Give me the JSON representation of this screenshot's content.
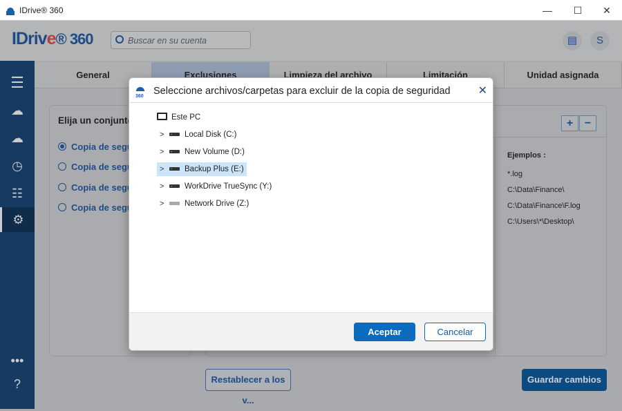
{
  "window": {
    "title": "IDrive® 360",
    "minimize": "—",
    "maximize": "☐",
    "close": "✕"
  },
  "header": {
    "brand_a": "IDriv",
    "brand_e": "e",
    "brand_b": "® 360",
    "search_placeholder": "Buscar en su cuenta",
    "avatar": "S"
  },
  "tabs": [
    "General",
    "Exclusiones",
    "Limpieza del archivo",
    "Limitación",
    "Unidad asignada"
  ],
  "left_panel": {
    "title": "Elija un conjunto",
    "options": [
      "Copia de seguridad",
      "Copia de seguridad",
      "Copia de seguridad",
      "Copia de seguridad"
    ]
  },
  "examples": {
    "title": "Ejemplos :",
    "items": [
      "*.log",
      "C:\\Data\\Finance\\",
      "C:\\Data\\Finance\\F.log",
      "C:\\Users\\*\\Desktop\\"
    ]
  },
  "buttons": {
    "add": "+",
    "remove": "−",
    "reset": "Restablecer a los v...",
    "save": "Guardar cambios"
  },
  "dialog": {
    "title": "Seleccione archivos/carpetas para excluir de la copia de seguridad",
    "root": "Este PC",
    "drives": [
      "Local Disk (C:)",
      "New Volume (D:)",
      "Backup Plus (E:)",
      "WorkDrive TrueSync (Y:)",
      "Network Drive (Z:)"
    ],
    "accept": "Aceptar",
    "cancel": "Cancelar"
  },
  "colors": {
    "accent": "#0a6bbf",
    "sidebar": "#163a62"
  }
}
